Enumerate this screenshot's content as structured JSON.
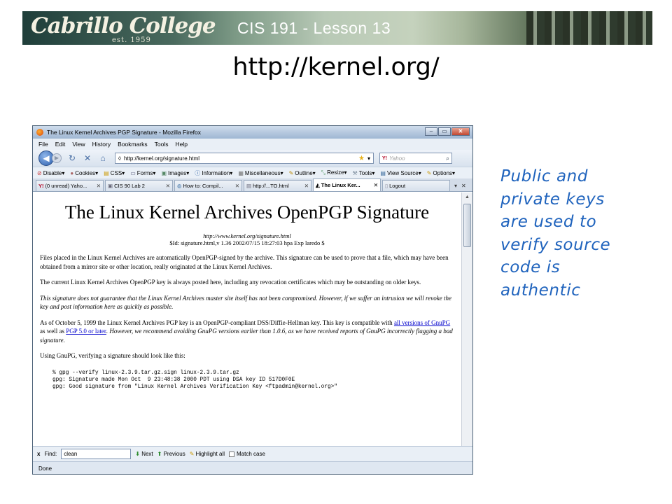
{
  "slide": {
    "banner": {
      "logo": "Cabrillo College",
      "logo_sub": "est. 1959",
      "title": "CIS 191 - Lesson 13"
    },
    "title": "http://kernel.org/",
    "side_note": "Public and private keys are used to verify source code is authentic"
  },
  "browser": {
    "window_title": "The Linux Kernel Archives PGP Signature - Mozilla Firefox",
    "window_buttons": {
      "minimize": "–",
      "maximize": "▭",
      "close": "✕"
    },
    "menu": [
      "File",
      "Edit",
      "View",
      "History",
      "Bookmarks",
      "Tools",
      "Help"
    ],
    "url": "http://kernel.org/signature.html",
    "search_placeholder": "Yahoo",
    "search_engine": "Y!",
    "devbar": [
      "Disable▾",
      "Cookies▾",
      "CSS▾",
      "Forms▾",
      "Images▾",
      "Information▾",
      "Miscellaneous▾",
      "Outline▾",
      "Resize▾",
      "Tools▾",
      "View Source▾",
      "Options▾"
    ],
    "tabs": [
      "(0 unread) Yaho...",
      "CIS 90 Lab 2",
      "How to: Compil...",
      "http://...TO.html",
      "The Linux Ker...",
      "Logout"
    ],
    "active_tab": 4,
    "status": "Done"
  },
  "page": {
    "heading": "The Linux Kernel Archives OpenPGP Signature",
    "url_line": "http://www.kernel.org/signature.html",
    "id_line": "$Id: signature.html,v 1.36 2002/07/15 18:27:03 hpa Exp laredo $",
    "p1": "Files placed in the Linux Kernel Archives are automatically OpenPGP-signed by the archive. This signature can be used to prove that a file, which may have been obtained from a mirror site or other location, really originated at the Linux Kernel Archives.",
    "p2": "The current Linux Kernel Archives OpenPGP key is always posted here, including any revocation certificates which may be outstanding on older keys.",
    "p3": "This signature does not guarantee that the Linux Kernel Archives master site itself has not been compromised. However, if we suffer an intrusion we will revoke the key and post information here as quickly as possible.",
    "p4_a": "As of October 5, 1999 the Linux Kernel Archives PGP key is an OpenPGP-compliant DSS/Diffie-Hellman key. This key is compatible with",
    "p4_link1": "all versions of GnuPG",
    "p4_b": "as well as",
    "p4_link2": "PGP 5.0 or later",
    "p4_c": ". However, we recommend avoiding GnuPG versions earlier than 1.0.6, as we have received reports of GnuPG incorrectly flagging a bad signature.",
    "p5": "Using GnuPG, verifying a signature should look like this:",
    "code": "% gpg --verify linux-2.3.9.tar.gz.sign linux-2.3.9.tar.gz\ngpg: Signature made Mon Oct  9 23:48:38 2000 PDT using DSA key ID 517D0F0E\ngpg: Good signature from \"Linux Kernel Archives Verification Key <ftpadmin@kernel.org>\""
  },
  "findbar": {
    "close": "x",
    "label": "Find:",
    "value": "clean",
    "next": "Next",
    "previous": "Previous",
    "highlight": "Highlight all",
    "match_case": "Match case"
  }
}
